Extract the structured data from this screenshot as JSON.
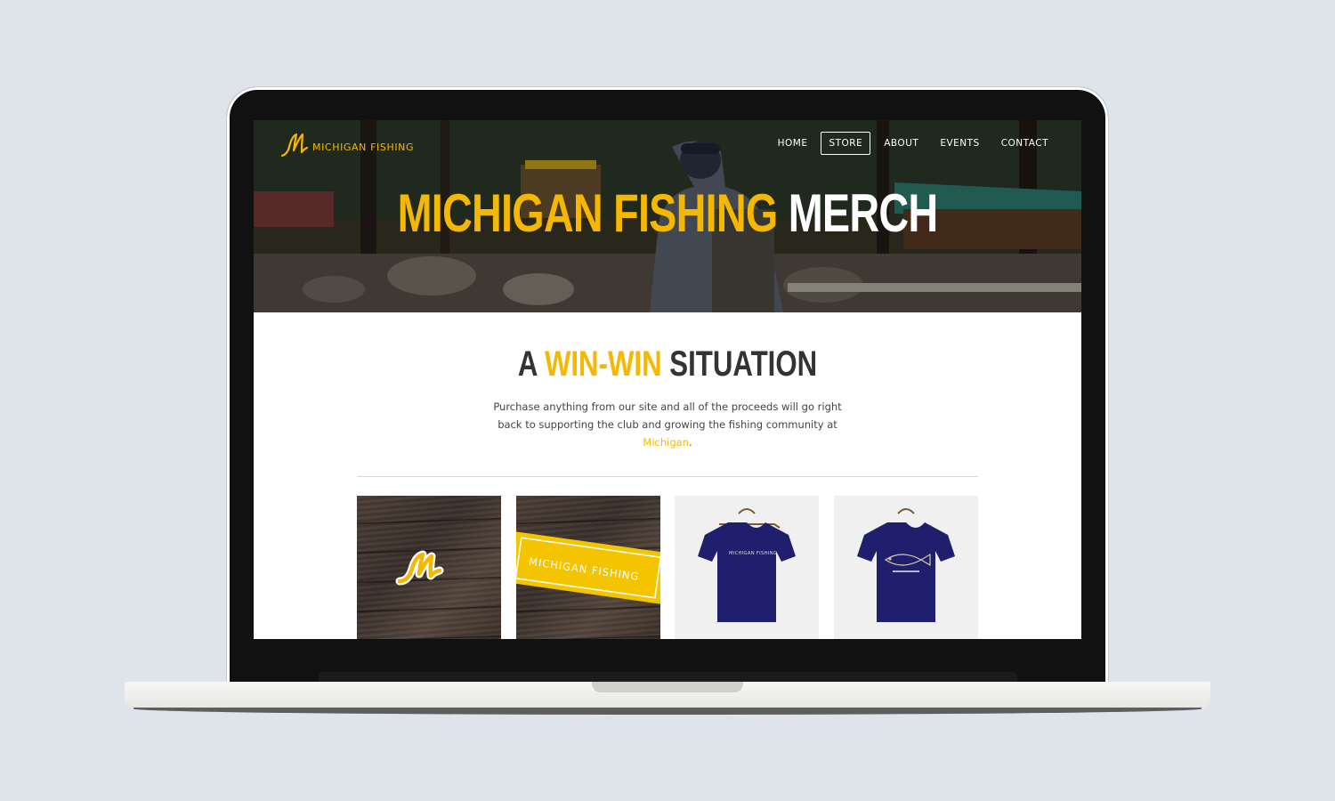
{
  "site": {
    "logo_text": "MICHIGAN FISHING",
    "nav": [
      "HOME",
      "STORE",
      "ABOUT",
      "EVENTS",
      "CONTACT"
    ],
    "active_nav": "STORE"
  },
  "hero": {
    "title_highlight": "MICHIGAN FISHING",
    "title_rest": "MERCH"
  },
  "section": {
    "title_a": "A",
    "title_highlight": "WIN-WIN",
    "title_rest": "SITUATION",
    "intro": "Purchase anything from our site and all of the proceeds will go right back to supporting the club and growing the fishing community at",
    "intro_link": "Michigan",
    "intro_end": "."
  },
  "products": [
    {
      "name": "logo-sticker-wood"
    },
    {
      "name": "banner-sticker-wood",
      "print": "MICHIGAN FISHING"
    },
    {
      "name": "tshirt-logo",
      "print": "MICHIGAN FISHING"
    },
    {
      "name": "tshirt-fish"
    }
  ],
  "colors": {
    "accent": "#f5b800",
    "heading": "#333333",
    "shirt": "#1f1f6e",
    "background": "#dfe3ea"
  }
}
